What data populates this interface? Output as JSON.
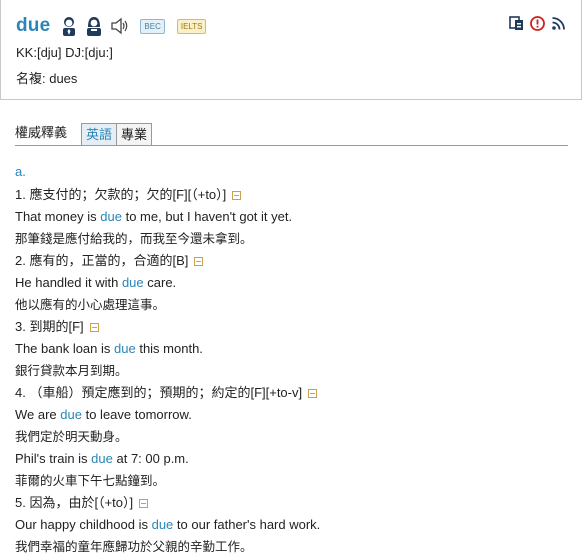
{
  "header": {
    "word": "due",
    "tags": [
      "BEC",
      "IELTS"
    ],
    "pronunciation": "KK:[dju] DJ:[dju:]",
    "forms": "名複: dues",
    "tool_icons": [
      "translate-icon",
      "report-icon",
      "rss-icon"
    ]
  },
  "tabs": {
    "title": "權威釋義",
    "items": [
      "英語",
      "專業"
    ],
    "active": 0
  },
  "pos": "a.",
  "lines": [
    {
      "type": "sense",
      "pre": "1. 應支付的；欠款的；欠的[F][（+to）]",
      "hl": "",
      "post": ""
    },
    {
      "type": "ex",
      "pre": "That money is ",
      "hl": "due",
      "post": " to me, but I haven't got it yet."
    },
    {
      "type": "zh",
      "pre": "那筆錢是應付給我的，而我至今還未拿到。",
      "hl": "",
      "post": ""
    },
    {
      "type": "sense",
      "pre": "2. 應有的，正當的，合適的[B]",
      "hl": "",
      "post": ""
    },
    {
      "type": "ex",
      "pre": "He handled it with ",
      "hl": "due",
      "post": " care."
    },
    {
      "type": "zh",
      "pre": "他以應有的小心處理這事。",
      "hl": "",
      "post": ""
    },
    {
      "type": "sense",
      "pre": "3. 到期的[F]",
      "hl": "",
      "post": ""
    },
    {
      "type": "ex",
      "pre": "The bank loan is ",
      "hl": "due",
      "post": " this month."
    },
    {
      "type": "zh",
      "pre": "銀行貸款本月到期。",
      "hl": "",
      "post": ""
    },
    {
      "type": "sense",
      "pre": "4. （車船）預定應到的；預期的；約定的[F][+to-v]",
      "hl": "",
      "post": ""
    },
    {
      "type": "ex",
      "pre": "We are ",
      "hl": "due",
      "post": " to leave tomorrow."
    },
    {
      "type": "zh",
      "pre": "我們定於明天動身。",
      "hl": "",
      "post": ""
    },
    {
      "type": "ex",
      "pre": "Phil's train is ",
      "hl": "due",
      "post": " at 7: 00 p.m."
    },
    {
      "type": "zh",
      "pre": "菲爾的火車下午七點鐘到。",
      "hl": "",
      "post": ""
    },
    {
      "type": "sense",
      "pre": "5. 因為，由於[（+to）]",
      "hl": "",
      "post": ""
    },
    {
      "type": "ex",
      "pre": "Our happy childhood is ",
      "hl": "due",
      "post": " to our father's hard work."
    },
    {
      "type": "zh",
      "pre": "我們幸福的童年應歸功於父親的辛勤工作。",
      "hl": "",
      "post": ""
    }
  ]
}
